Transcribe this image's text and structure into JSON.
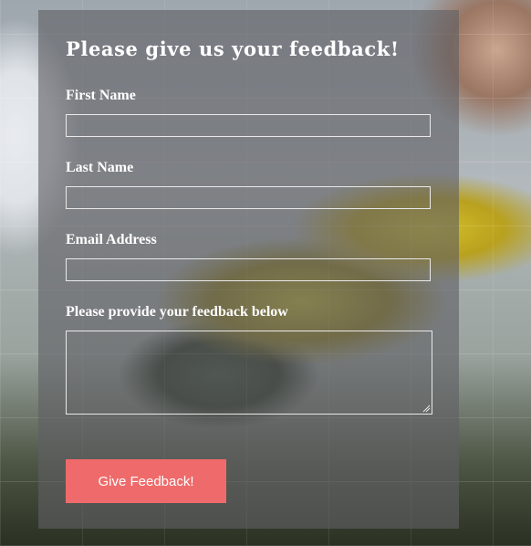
{
  "form": {
    "title": "Please give us your feedback!",
    "fields": {
      "first_name": {
        "label": "First Name",
        "value": ""
      },
      "last_name": {
        "label": "Last Name",
        "value": ""
      },
      "email": {
        "label": "Email Address",
        "value": ""
      },
      "feedback": {
        "label": "Please provide your feedback below",
        "value": ""
      }
    },
    "submit_label": "Give Feedback!"
  },
  "colors": {
    "panel_overlay": "rgba(95,95,100,0.62)",
    "button_bg": "#ef6a6a",
    "text": "#ffffff",
    "field_border": "#e9e9e9"
  }
}
